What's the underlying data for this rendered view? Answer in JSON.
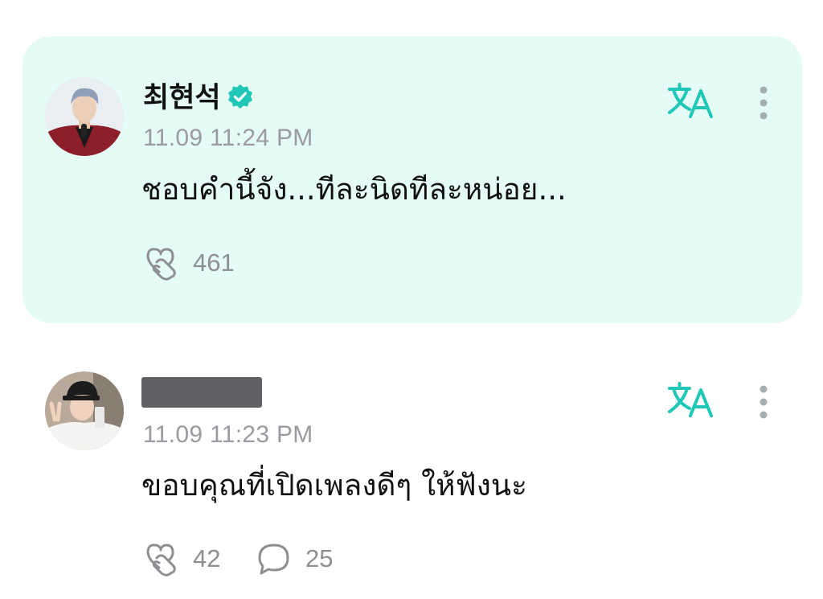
{
  "posts": [
    {
      "author": "최현석",
      "verified": true,
      "timestamp": "11.09 11:24 PM",
      "text": "ชอบคำนี้จัง...ทีละนิดทีละหน่อย...",
      "reactions": "461",
      "highlighted": true
    },
    {
      "author": "",
      "author_redacted": true,
      "timestamp": "11.09 11:23 PM",
      "text": "ขอบคุณที่เปิดเพลงดีๆ ให้ฟังนะ",
      "reactions": "42",
      "comments": "25",
      "highlighted": false
    }
  ],
  "icons": {
    "translate": "translate-icon",
    "more": "more-vertical-icon",
    "reaction": "heart-hand-icon",
    "comment": "comment-bubble-icon",
    "verified": "verified-badge-icon"
  },
  "colors": {
    "accent": "#1fc7b6",
    "highlight_bg": "#e4fbf6",
    "muted_text": "#9a9aa0",
    "more_dots": "#a7aeb3"
  }
}
